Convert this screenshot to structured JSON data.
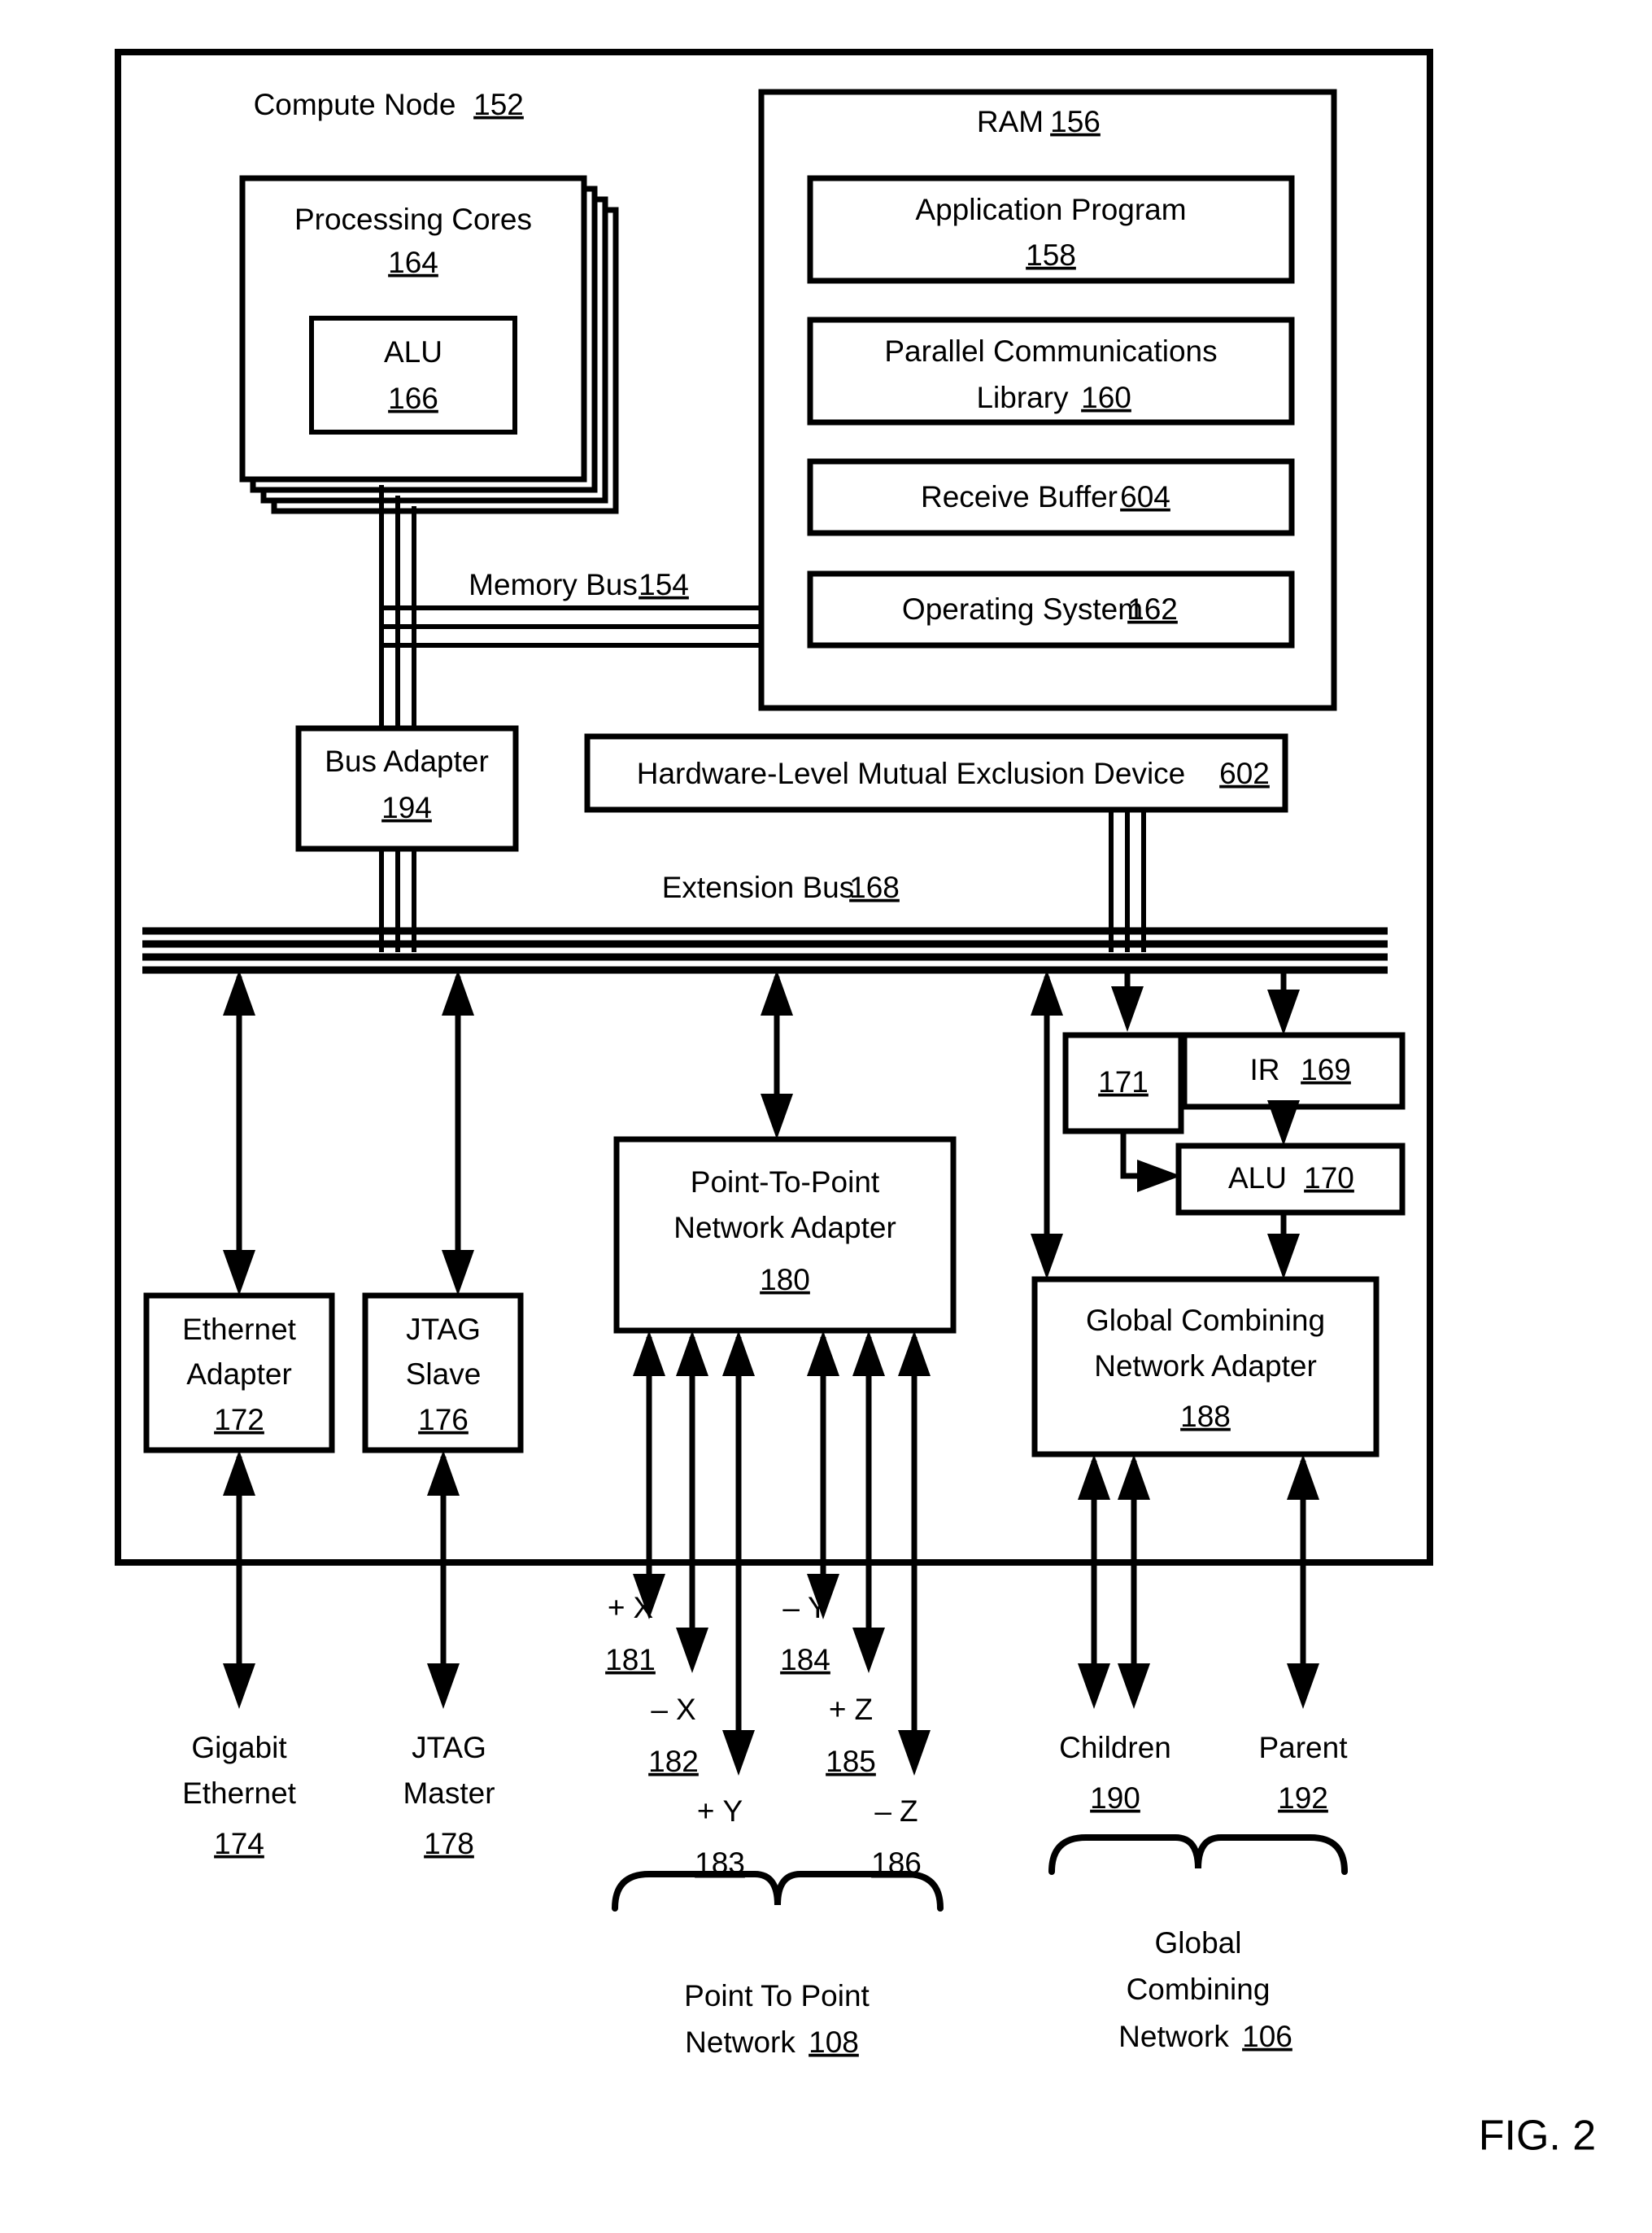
{
  "figure": {
    "caption": "FIG. 2"
  },
  "node": {
    "title": "Compute Node",
    "ref": "152"
  },
  "cores": {
    "title_line1": "Processing Cores",
    "ref": "164",
    "alu": {
      "title": "ALU",
      "ref": "166"
    }
  },
  "ram": {
    "title": "RAM",
    "ref": "156",
    "items": [
      {
        "label": "Application Program",
        "ref": "158",
        "two_line": true
      },
      {
        "label": "Parallel Communications",
        "label2": "Library",
        "ref": "160",
        "two_line": true
      },
      {
        "label": "Receive Buffer",
        "ref": "604",
        "two_line": false
      },
      {
        "label": "Operating System",
        "ref": "162",
        "two_line": false
      }
    ]
  },
  "memory_bus": {
    "label": "Memory Bus",
    "ref": "154"
  },
  "bus_adapter": {
    "label": "Bus Adapter",
    "ref": "194"
  },
  "mutex": {
    "label": "Hardware-Level Mutual Exclusion Device",
    "ref": "602"
  },
  "extension_bus": {
    "label": "Extension Bus",
    "ref": "168"
  },
  "counter": {
    "ref": "171"
  },
  "ir": {
    "label": "IR",
    "ref": "169"
  },
  "alu_net": {
    "label": "ALU",
    "ref": "170"
  },
  "adapters": {
    "ethernet": {
      "line1": "Ethernet",
      "line2": "Adapter",
      "ref": "172"
    },
    "jtag": {
      "line1": "JTAG",
      "line2": "Slave",
      "ref": "176"
    },
    "p2p": {
      "line1": "Point-To-Point",
      "line2": "Network Adapter",
      "ref": "180"
    },
    "gcn": {
      "line1": "Global Combining",
      "line2": "Network Adapter",
      "ref": "188"
    }
  },
  "external": {
    "gigabit": {
      "line1": "Gigabit",
      "line2": "Ethernet",
      "ref": "174"
    },
    "jtag_master": {
      "line1": "JTAG",
      "line2": "Master",
      "ref": "178"
    },
    "children": {
      "label": "Children",
      "ref": "190"
    },
    "parent": {
      "label": "Parent",
      "ref": "192"
    }
  },
  "torus_links": [
    {
      "sign": "+",
      "axis": "X",
      "ref": "181"
    },
    {
      "sign": "–",
      "axis": "X",
      "ref": "182"
    },
    {
      "sign": "+",
      "axis": "Y",
      "ref": "183"
    },
    {
      "sign": "–",
      "axis": "Y",
      "ref": "184"
    },
    {
      "sign": "+",
      "axis": "Z",
      "ref": "185"
    },
    {
      "sign": "–",
      "axis": "Z",
      "ref": "186"
    }
  ],
  "networks": {
    "p2p": {
      "line1": "Point To Point",
      "line2": "Network",
      "ref": "108"
    },
    "gcn": {
      "line1": "Global",
      "line2": "Combining",
      "line3": "Network",
      "ref": "106"
    }
  }
}
